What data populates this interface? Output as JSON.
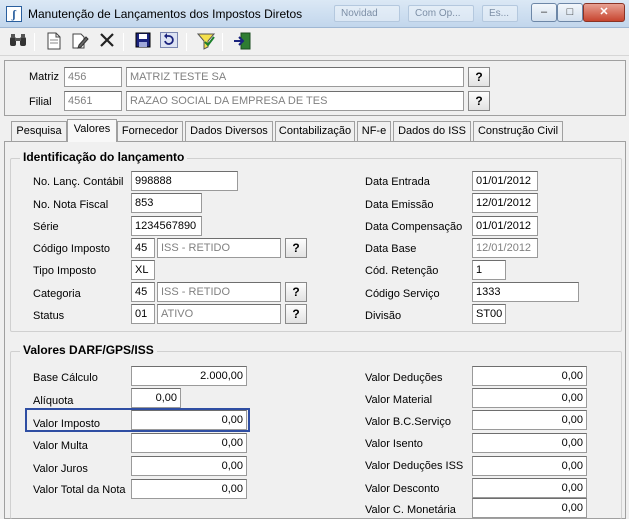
{
  "window": {
    "title": "Manutenção de Lançamentos dos Impostos Diretos",
    "ghost_tabs": [
      "Novidad",
      "Com Op...",
      "Es..."
    ],
    "buttons": {
      "minimize": "–",
      "maximize": "□",
      "close": "✕"
    }
  },
  "toolbar": {
    "icons": [
      "binoculars-icon",
      "new-document-icon",
      "edit-icon",
      "delete-icon",
      "save-icon",
      "undo-icon",
      "filter-check-icon",
      "exit-icon"
    ]
  },
  "header": {
    "matriz": {
      "label": "Matriz",
      "code": "456",
      "name": "MATRIZ TESTE SA"
    },
    "filial": {
      "label": "Filial",
      "code": "4561",
      "name": "RAZAO SOCIAL DA EMPRESA DE TES"
    },
    "help_label": "?"
  },
  "tabs": [
    {
      "label": "Pesquisa"
    },
    {
      "label": "Valores"
    },
    {
      "label": "Fornecedor"
    },
    {
      "label": "Dados Diversos"
    },
    {
      "label": "Contabilização"
    },
    {
      "label": "NF-e"
    },
    {
      "label": "Dados do ISS"
    },
    {
      "label": "Construção Civil"
    }
  ],
  "active_tab": "Valores",
  "identificacao": {
    "title": "Identificação do lançamento",
    "no_lanc_contabil": {
      "label": "No. Lanç. Contábil",
      "value": "998888"
    },
    "no_nota_fiscal": {
      "label": "No. Nota Fiscal",
      "value": "853"
    },
    "serie": {
      "label": "Série",
      "value": "1234567890"
    },
    "codigo_imposto": {
      "label": "Código Imposto",
      "code": "45",
      "desc": "ISS - RETIDO"
    },
    "tipo_imposto": {
      "label": "Tipo Imposto",
      "value": "XL"
    },
    "categoria": {
      "label": "Categoria",
      "code": "45",
      "desc": "ISS - RETIDO"
    },
    "status": {
      "label": "Status",
      "code": "01",
      "desc": "ATIVO"
    },
    "data_entrada": {
      "label": "Data Entrada",
      "value": "01/01/2012"
    },
    "data_emissao": {
      "label": "Data Emissão",
      "value": "12/01/2012"
    },
    "data_compensacao": {
      "label": "Data Compensação",
      "value": "01/01/2012"
    },
    "data_base": {
      "label": "Data Base",
      "value": "12/01/2012"
    },
    "cod_retencao": {
      "label": "Cód. Retenção",
      "value": "1"
    },
    "codigo_servico": {
      "label": "Código Serviço",
      "value": "1333"
    },
    "divisao": {
      "label": "Divisão",
      "value": "ST00"
    }
  },
  "valores": {
    "title": "Valores DARF/GPS/ISS",
    "base_calculo": {
      "label": "Base Cálculo",
      "value": "2.000,00"
    },
    "aliquota": {
      "label": "Alíquota",
      "value": "0,00"
    },
    "valor_imposto": {
      "label": "Valor Imposto",
      "value": "0,00"
    },
    "valor_multa": {
      "label": "Valor Multa",
      "value": "0,00"
    },
    "valor_juros": {
      "label": "Valor Juros",
      "value": "0,00"
    },
    "valor_total_nota": {
      "label": "Valor Total da Nota",
      "value": "0,00"
    },
    "valor_deducoes": {
      "label": "Valor Deduções",
      "value": "0,00"
    },
    "valor_material": {
      "label": "Valor Material",
      "value": "0,00"
    },
    "valor_bc_servico": {
      "label": "Valor B.C.Serviço",
      "value": "0,00"
    },
    "valor_isento": {
      "label": "Valor Isento",
      "value": "0,00"
    },
    "valor_deducoes_iss": {
      "label": "Valor Deduções ISS",
      "value": "0,00"
    },
    "valor_desconto": {
      "label": "Valor Desconto",
      "value": "0,00"
    },
    "valor_c_monetaria": {
      "label": "Valor C. Monetária",
      "value": "0,00"
    }
  }
}
